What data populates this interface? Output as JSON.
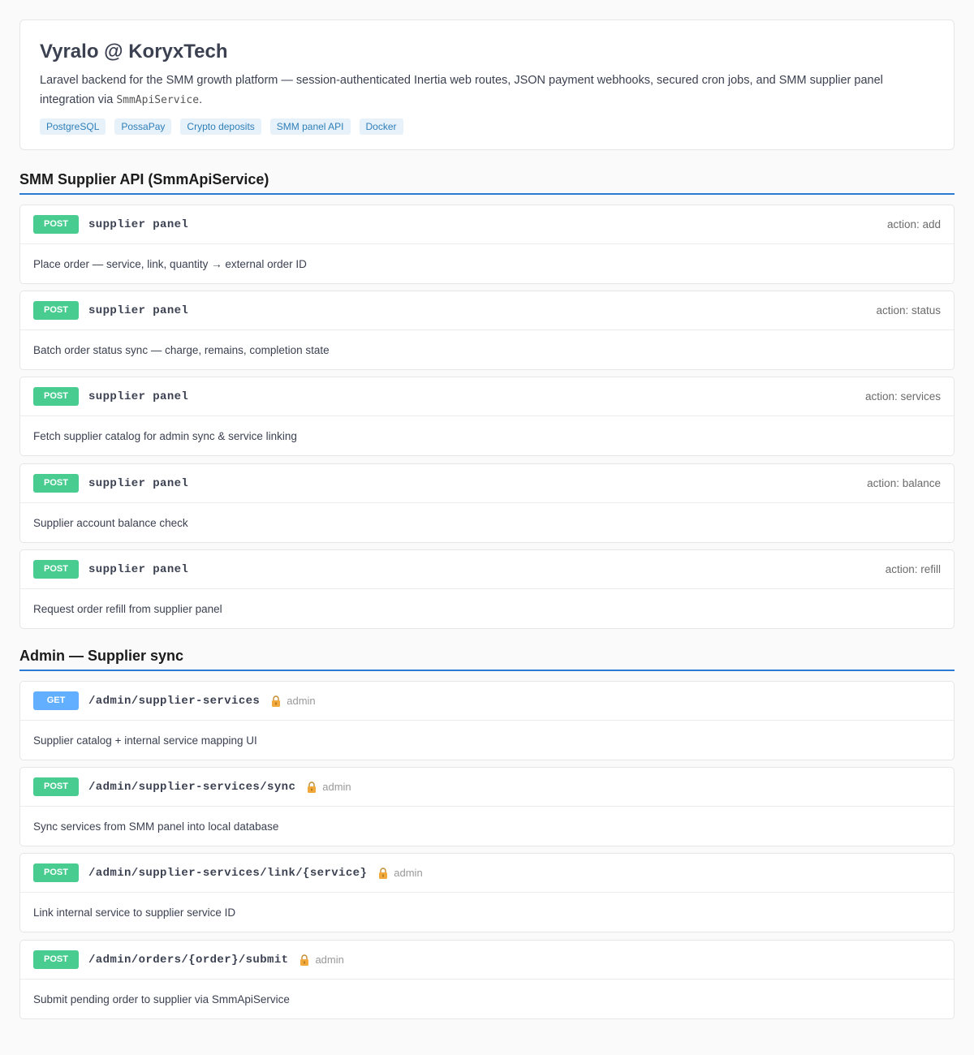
{
  "info": {
    "title": "Vyralo @ KoryxTech",
    "description_pre": "Laravel backend for the SMM growth platform — session-authenticated Inertia web routes, JSON payment webhooks, secured cron jobs, and SMM supplier panel integration via ",
    "description_code": "SmmApiService",
    "description_post": ".",
    "tags": [
      "PostgreSQL",
      "PossaPay",
      "Crypto deposits",
      "SMM panel API",
      "Docker"
    ]
  },
  "sections": [
    {
      "title": "SMM Supplier API (SmmApiService)",
      "operations": [
        {
          "method": "POST",
          "path": "supplier panel",
          "note": "action: add",
          "description": "Place order — service, link, quantity → external order ID"
        },
        {
          "method": "POST",
          "path": "supplier panel",
          "note": "action: status",
          "description": "Batch order status sync — charge, remains, completion state"
        },
        {
          "method": "POST",
          "path": "supplier panel",
          "note": "action: services",
          "description": "Fetch supplier catalog for admin sync & service linking"
        },
        {
          "method": "POST",
          "path": "supplier panel",
          "note": "action: balance",
          "description": "Supplier account balance check"
        },
        {
          "method": "POST",
          "path": "supplier panel",
          "note": "action: refill",
          "description": "Request order refill from supplier panel"
        }
      ]
    },
    {
      "title": "Admin — Supplier sync",
      "operations": [
        {
          "method": "GET",
          "path": "/admin/supplier-services",
          "auth": "admin",
          "description": "Supplier catalog + internal service mapping UI"
        },
        {
          "method": "POST",
          "path": "/admin/supplier-services/sync",
          "auth": "admin",
          "description": "Sync services from SMM panel into local database"
        },
        {
          "method": "POST",
          "path": "/admin/supplier-services/link/{service}",
          "auth": "admin",
          "description": "Link internal service to supplier service ID"
        },
        {
          "method": "POST",
          "path": "/admin/orders/{order}/submit",
          "auth": "admin",
          "description": "Submit pending order to supplier via SmmApiService"
        }
      ]
    }
  ],
  "colors": {
    "post": "#49cc90",
    "get": "#61affe",
    "section_rule": "#2b7bd2",
    "tag_text": "#2f7fb8",
    "tag_bg": "#e6f1fa"
  },
  "icons": {
    "auth": "lock-icon"
  }
}
